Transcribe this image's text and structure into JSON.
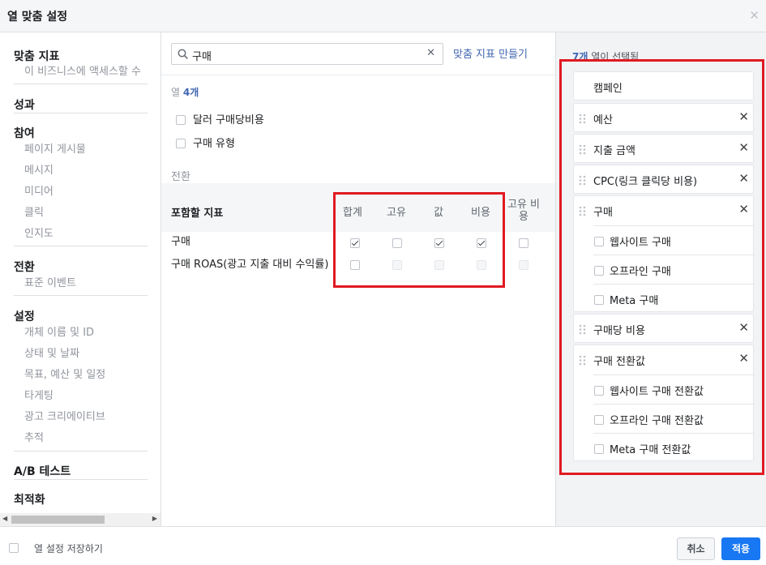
{
  "dialog": {
    "title": "열 맞춤 설정"
  },
  "sidebar": {
    "sections": [
      {
        "title": "맞춤 지표",
        "items": [
          "이 비즈니스에 액세스할 수"
        ]
      },
      {
        "title": "성과",
        "items": []
      },
      {
        "title": "참여",
        "items": [
          "페이지 게시물",
          "메시지",
          "미디어",
          "클릭",
          "인지도"
        ]
      },
      {
        "title": "전환",
        "items": [
          "표준 이벤트"
        ]
      },
      {
        "title": "설정",
        "items": [
          "개체 이름 및 ID",
          "상태 및 날짜",
          "목표, 예산 및 일정",
          "타게팅",
          "광고 크리에이티브",
          "추적"
        ]
      },
      {
        "title": "A/B 테스트",
        "items": []
      },
      {
        "title": "최적화",
        "items": []
      }
    ]
  },
  "search": {
    "value": "구매",
    "create_link": "맞춤 지표 만들기"
  },
  "results": {
    "count_prefix": "열 ",
    "count_value": "4개",
    "plain_options": [
      {
        "label": "달러 구매당비용",
        "checked": false
      },
      {
        "label": "구매 유형",
        "checked": false
      }
    ],
    "conversion_header": "전환",
    "table": {
      "row_header": "포함할 지표",
      "columns": [
        "합계",
        "고유",
        "값",
        "비용",
        "고유 비용"
      ],
      "rows": [
        {
          "label": "구매",
          "checks": [
            true,
            false,
            true,
            true,
            false
          ],
          "disabled": [
            false,
            false,
            false,
            false,
            false
          ]
        },
        {
          "label": "구매 ROAS(광고 지출 대비 수익률)",
          "checks": [
            false,
            false,
            false,
            false,
            false
          ],
          "disabled": [
            false,
            true,
            true,
            true,
            true
          ]
        }
      ]
    }
  },
  "selected": {
    "count_value": "7개",
    "count_suffix": " 열이 선택됨",
    "fixed": "캠페인",
    "items": [
      {
        "label": "예산"
      },
      {
        "label": "지출 금액"
      },
      {
        "label": "CPC(링크 클릭당 비용)"
      },
      {
        "label": "구매",
        "subs": [
          "웹사이트 구매",
          "오프라인 구매",
          "Meta 구매"
        ]
      },
      {
        "label": "구매당 비용"
      },
      {
        "label": "구매 전환값",
        "subs": [
          "웹사이트 구매 전환값",
          "오프라인 구매 전환값",
          "Meta 구매 전환값"
        ]
      }
    ]
  },
  "footer": {
    "save_label": "열 설정 저장하기",
    "cancel_label": "취소",
    "apply_label": "적용"
  },
  "colors": {
    "accent": "#4267b2",
    "primary_button": "#1877f2",
    "highlight": "#e01a22"
  }
}
